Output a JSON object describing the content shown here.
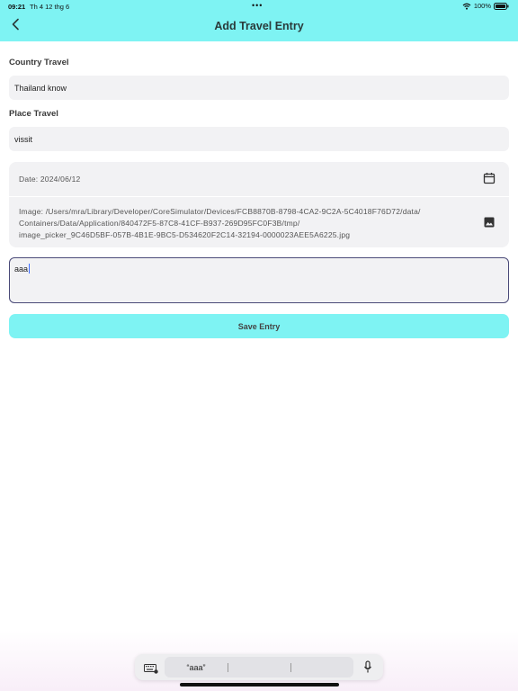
{
  "status_bar": {
    "time": "09:21",
    "date": "Th 4 12 thg 6",
    "dots": "•••",
    "battery": "100%"
  },
  "header": {
    "title": "Add Travel Entry",
    "back_icon": "chevron-left-icon",
    "background_color": "#7ef3f3"
  },
  "form": {
    "country_label": "Country Travel",
    "country_value": "Thailand know",
    "place_label": "Place Travel",
    "place_value": "vissit",
    "date_text": "Date: 2024/06/12",
    "date_icon": "calendar-icon",
    "image_lines": [
      "Image: /Users/mra/Library/Developer/CoreSimulator/Devices/FCB8870B-8798-4CA2-9C2A-5C4018F76D72/data/",
      "Containers/Data/Application/840472F5-87C8-41CF-B937-269D95FC0F3B/tmp/",
      "image_picker_9C46D5BF-057B-4B1E-9BC5-D534620F2C14-32194-0000023AEE5A6225.jpg"
    ],
    "image_icon": "image-icon",
    "note_value": "aaa",
    "save_label": "Save Entry"
  },
  "keyboard_bar": {
    "suggestions": [
      "“aaa”",
      "",
      ""
    ],
    "keyboard_icon": "keyboard-icon",
    "mic_icon": "microphone-icon"
  }
}
